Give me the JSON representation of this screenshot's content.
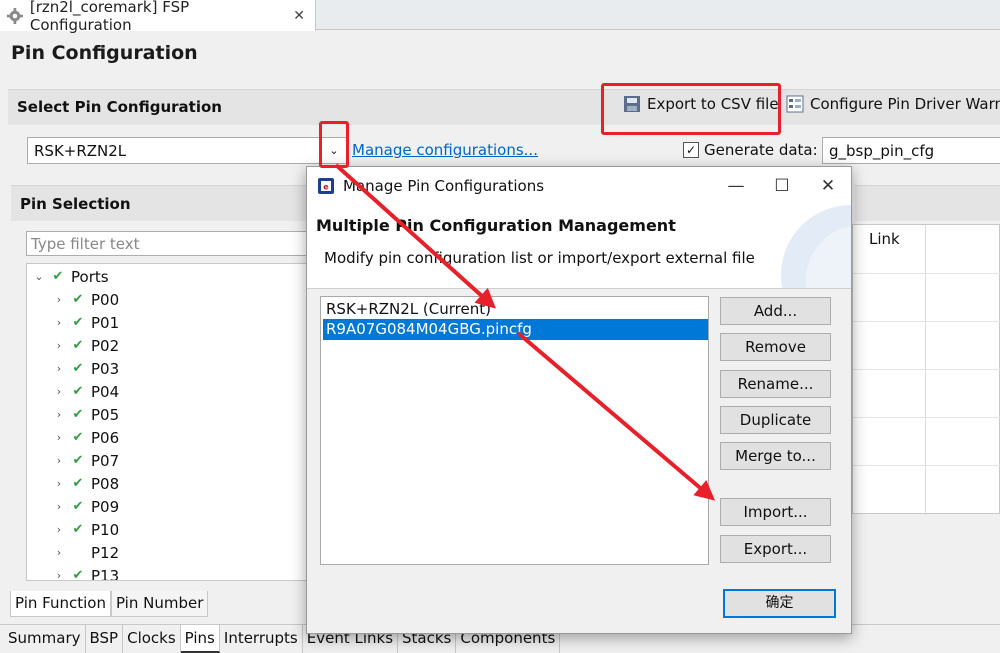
{
  "editor_tab": {
    "title": "[rzn2l_coremark] FSP Configuration",
    "close": "✕"
  },
  "page": {
    "title": "Pin Configuration"
  },
  "select_section": {
    "header": "Select Pin Configuration",
    "export_csv": "Export to CSV file",
    "configure_driver": "Configure Pin Driver Warni",
    "combo_value": "RSK+RZN2L",
    "manage_link": "Manage configurations...",
    "generate_label": "Generate data:",
    "generate_checked": true,
    "generate_value": "g_bsp_pin_cfg"
  },
  "pin_selection": {
    "header": "Pin Selection",
    "filter_placeholder": "Type filter text",
    "tree": [
      {
        "label": "Ports",
        "checked": true,
        "expanded": true,
        "level": 0
      },
      {
        "label": "P00",
        "checked": true,
        "level": 1
      },
      {
        "label": "P01",
        "checked": true,
        "level": 1
      },
      {
        "label": "P02",
        "checked": true,
        "level": 1
      },
      {
        "label": "P03",
        "checked": true,
        "level": 1
      },
      {
        "label": "P04",
        "checked": true,
        "level": 1
      },
      {
        "label": "P05",
        "checked": true,
        "level": 1
      },
      {
        "label": "P06",
        "checked": true,
        "level": 1
      },
      {
        "label": "P07",
        "checked": true,
        "level": 1
      },
      {
        "label": "P08",
        "checked": true,
        "level": 1
      },
      {
        "label": "P09",
        "checked": true,
        "level": 1
      },
      {
        "label": "P10",
        "checked": true,
        "level": 1
      },
      {
        "label": "P12",
        "checked": false,
        "level": 1
      },
      {
        "label": "P13",
        "checked": true,
        "level": 1
      }
    ]
  },
  "right_panel": {
    "column_header": "Link"
  },
  "sub_tabs": [
    "Pin Function",
    "Pin Number"
  ],
  "bottom_tabs": [
    "Summary",
    "BSP",
    "Clocks",
    "Pins",
    "Interrupts",
    "Event Links",
    "Stacks",
    "Components"
  ],
  "active_bottom_tab": "Pins",
  "dialog": {
    "title": "Manage Pin Configurations",
    "heading": "Multiple Pin Configuration Management",
    "description": "Modify pin configuration list or import/export external file",
    "list": [
      {
        "label": "RSK+RZN2L (Current)",
        "selected": false
      },
      {
        "label": "R9A07G084M04GBG.pincfg",
        "selected": true
      }
    ],
    "buttons": {
      "add": "Add...",
      "remove": "Remove",
      "rename": "Rename...",
      "duplicate": "Duplicate",
      "merge": "Merge to...",
      "import": "Import...",
      "export": "Export..."
    },
    "ok": "确定",
    "minimize": "—",
    "maximize": "☐",
    "close": "✕"
  },
  "colors": {
    "annotation_red": "#e8202a",
    "selection_blue": "#0078d7",
    "link_blue": "#0066cc",
    "check_green": "#2e9e3d"
  },
  "icons": [
    "gear-icon",
    "csv-export-icon",
    "driver-config-icon",
    "dropdown-arrow-icon",
    "checkbox-icon",
    "renesas-app-icon",
    "expand-arrow-icon",
    "check-icon"
  ]
}
